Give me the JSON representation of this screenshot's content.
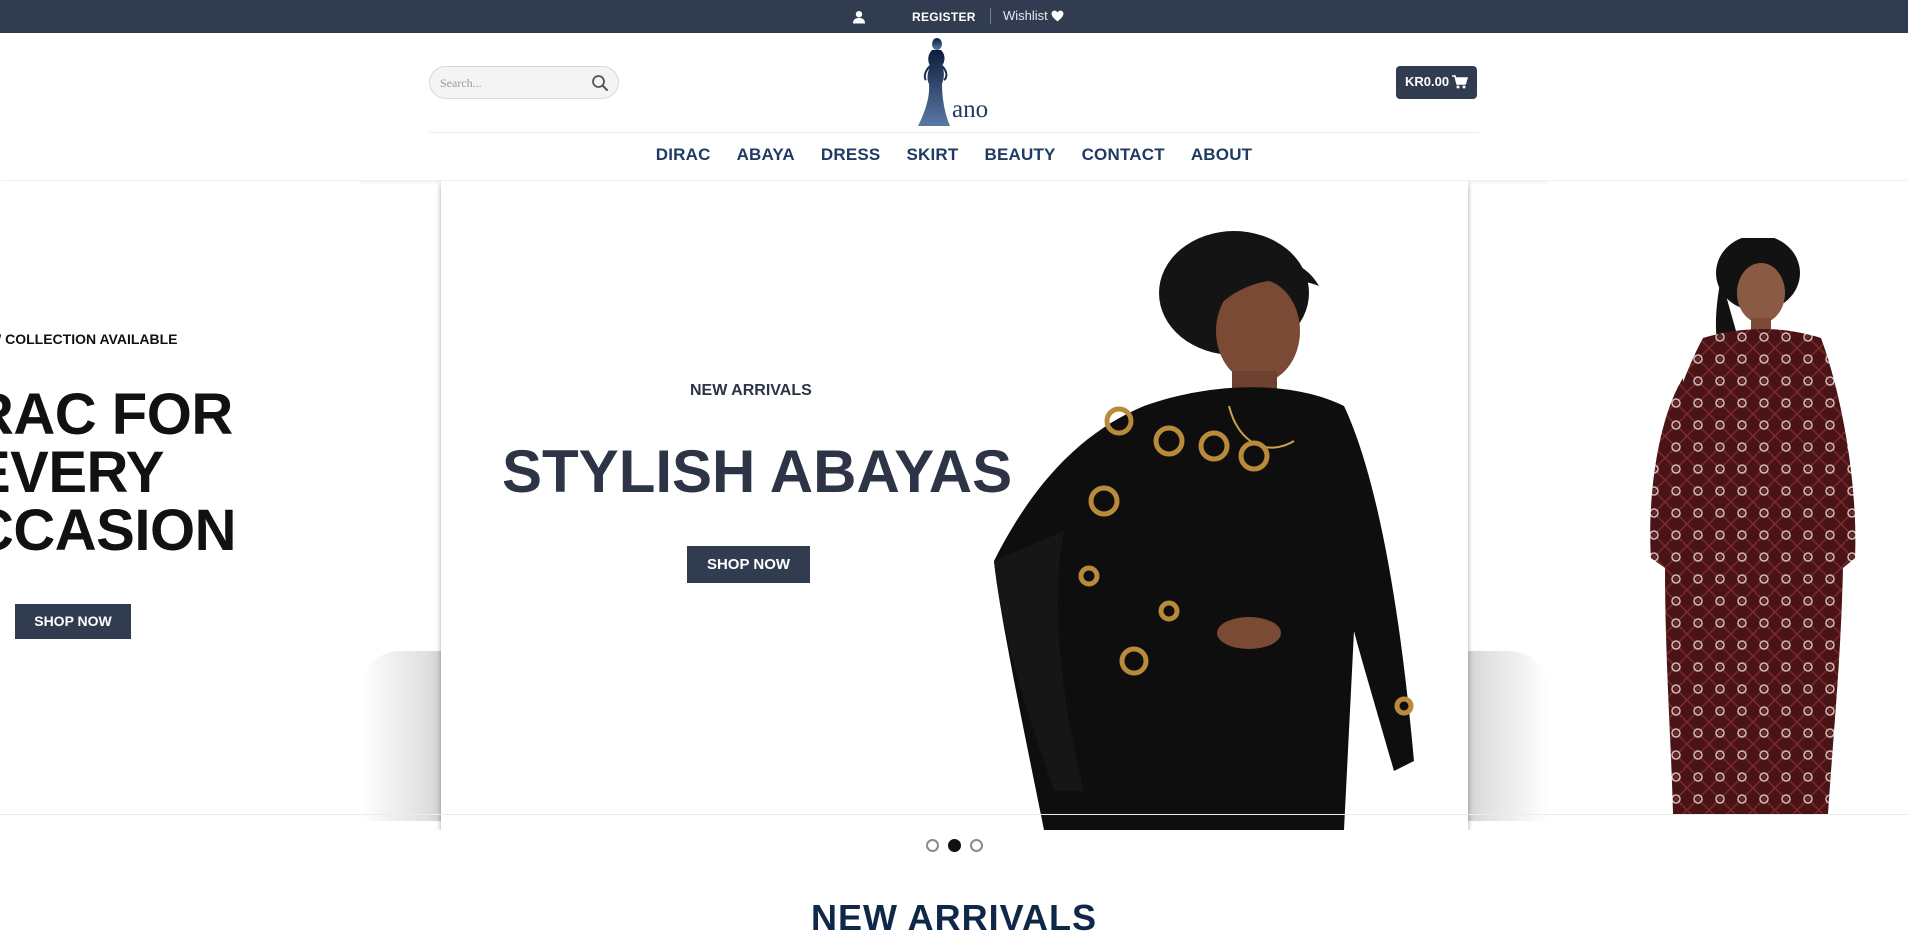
{
  "topbar": {
    "register": "REGISTER",
    "wishlist": "Wishlist",
    "icons": [
      "user-icon",
      "heart-icon"
    ]
  },
  "header": {
    "search_placeholder": "Search...",
    "logo_text": "ano",
    "cart_total": "KR0.00",
    "nav": [
      "DIRAC",
      "ABAYA",
      "DRESS",
      "SKIRT",
      "BEAUTY",
      "CONTACT",
      "ABOUT"
    ]
  },
  "slider": {
    "left": {
      "kicker": "W COLLECTION AVAILABLE",
      "heading": "RAC FOR\nEVERY\nCCASION",
      "cta": "SHOP NOW"
    },
    "main": {
      "kicker": "NEW ARRIVALS",
      "heading": "STYLISH ABAYAS",
      "cta": "SHOP NOW"
    },
    "dots": {
      "count": 3,
      "active_index": 1
    }
  },
  "section": {
    "title": "NEW ARRIVALS"
  },
  "colors": {
    "brand_dark": "#313c51",
    "nav_blue": "#1f3b64"
  }
}
